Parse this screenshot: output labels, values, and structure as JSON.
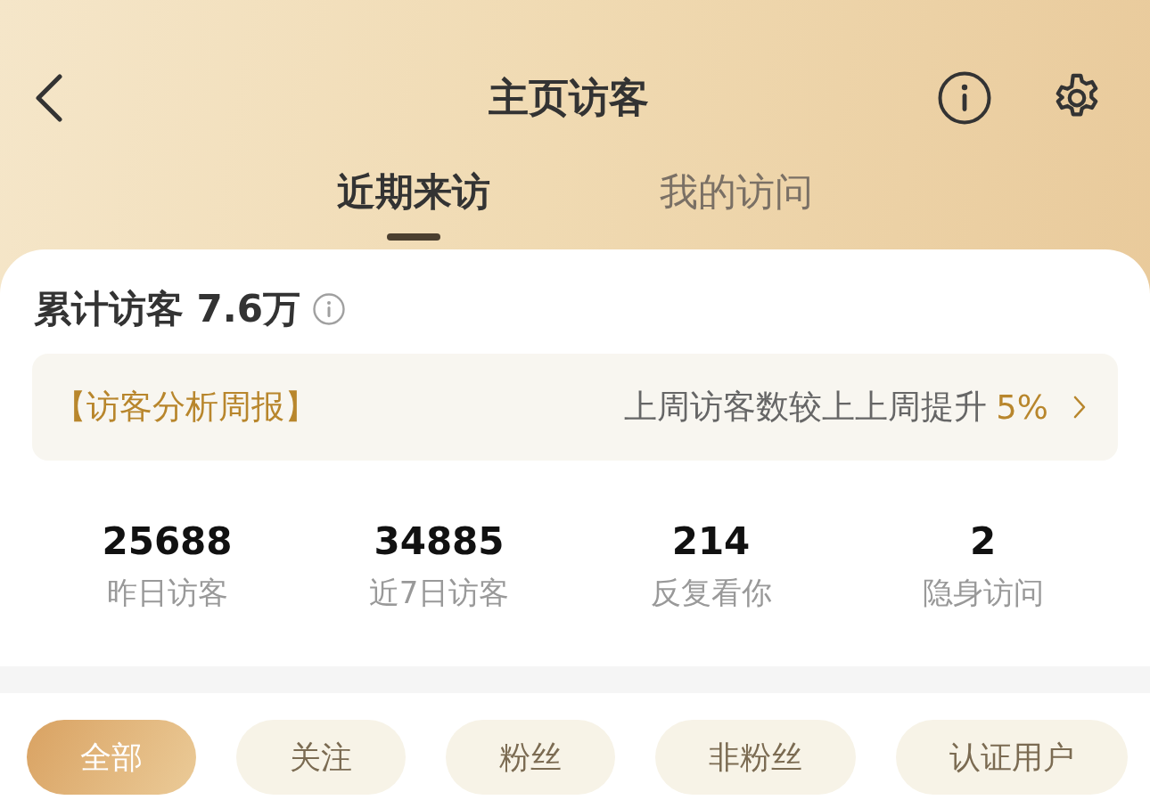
{
  "header": {
    "title": "主页访客"
  },
  "tabs": [
    {
      "label": "近期来访",
      "selected": true
    },
    {
      "label": "我的访问",
      "selected": false
    }
  ],
  "summary": {
    "text": "累计访客 7.6万"
  },
  "weekly_report": {
    "title": "【访客分析周报】",
    "text": "上周访客数较上上周提升",
    "change": "5%"
  },
  "stats": [
    {
      "value": "25688",
      "label": "昨日访客"
    },
    {
      "value": "34885",
      "label": "近7日访客"
    },
    {
      "value": "214",
      "label": "反复看你"
    },
    {
      "value": "2",
      "label": "隐身访问"
    }
  ],
  "filters": [
    {
      "label": "全部",
      "selected": true
    },
    {
      "label": "关注",
      "selected": false
    },
    {
      "label": "粉丝",
      "selected": false
    },
    {
      "label": "非粉丝",
      "selected": false
    },
    {
      "label": "认证用户",
      "selected": false
    }
  ]
}
